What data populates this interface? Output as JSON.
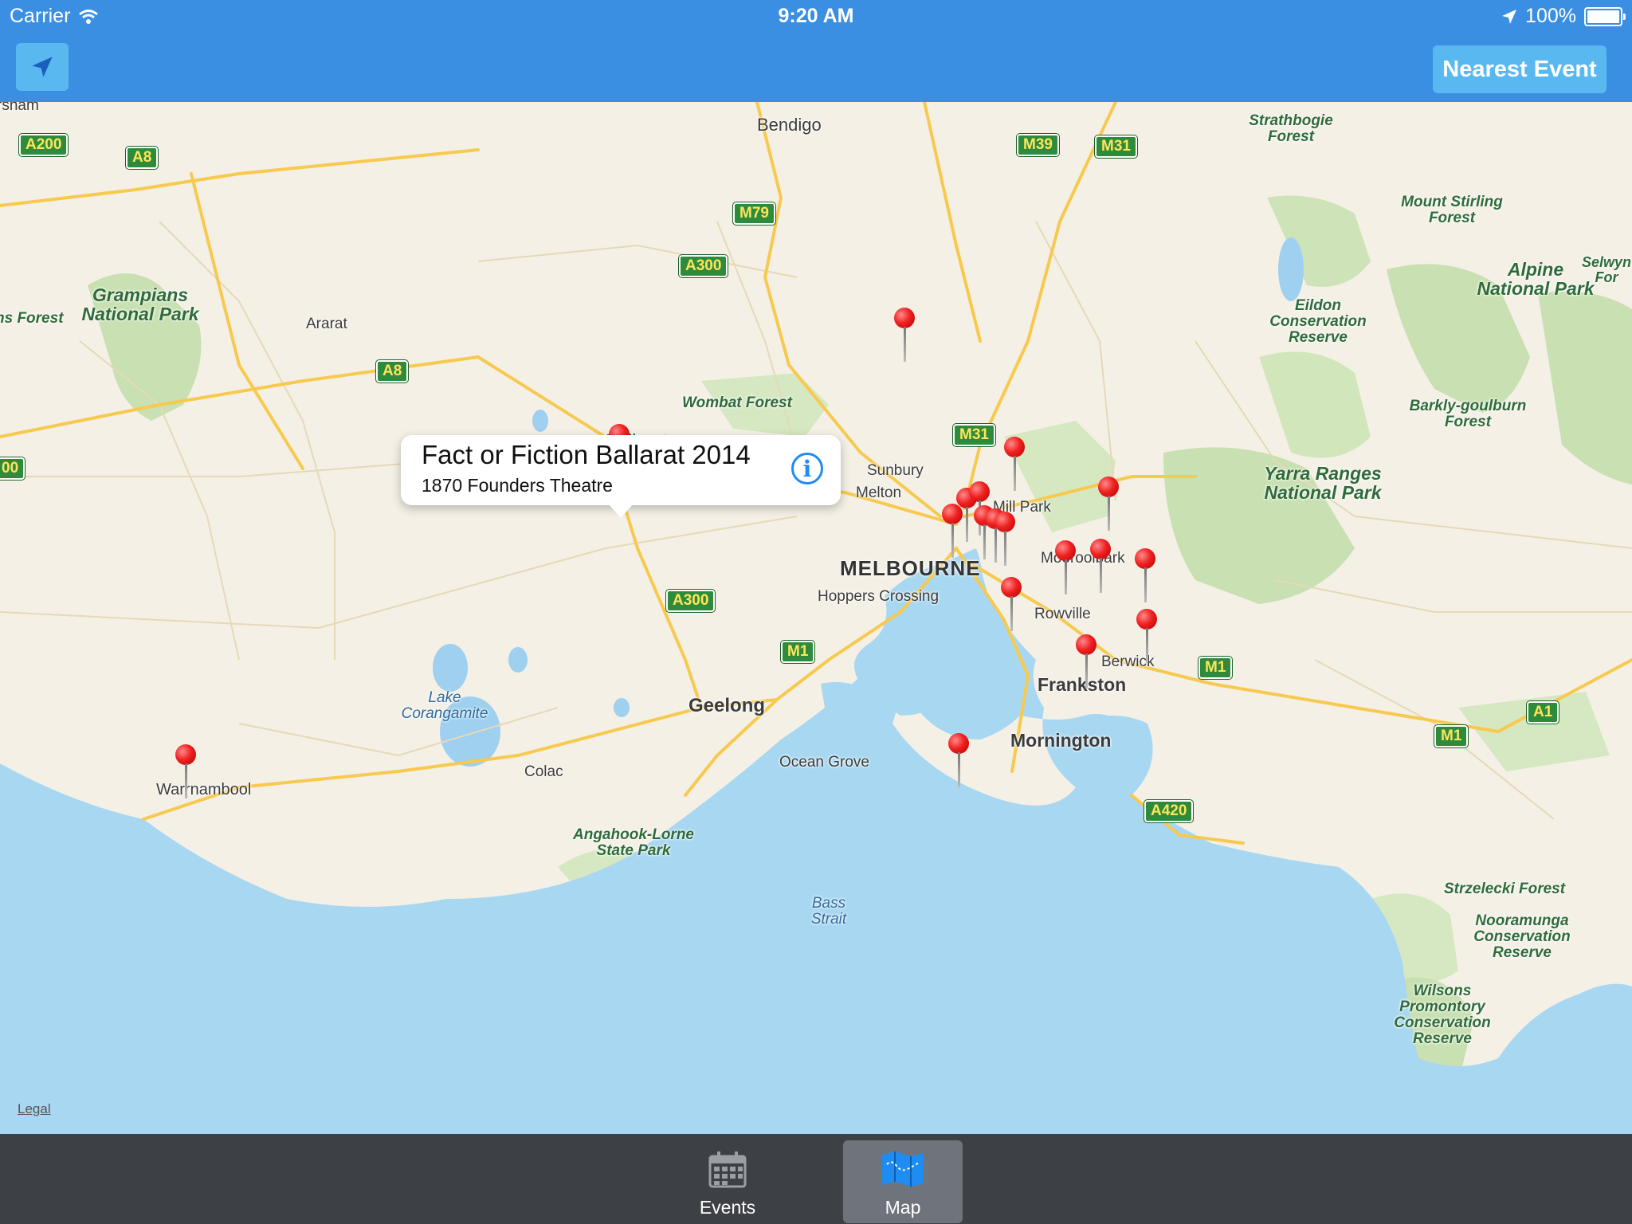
{
  "status_bar": {
    "carrier": "Carrier",
    "time": "9:20 AM",
    "battery": "100%"
  },
  "nav": {
    "nearest_label": "Nearest Event"
  },
  "map": {
    "cities": {
      "bendigo": "Bendigo",
      "ararat": "Ararat",
      "ballarat": "Ballarat",
      "sunbury": "Sunbury",
      "melton": "Melton",
      "melbourne": "MELBOURNE",
      "hoppers": "Hoppers Crossing",
      "rowville": "Rowville",
      "berwick": "Berwick",
      "frankston": "Frankston",
      "geelong": "Geelong",
      "ocean_grove": "Ocean Grove",
      "mornington": "Mornington",
      "colac": "Colac",
      "warrnambool": "Warrnambool",
      "mill_park": "Mill Park",
      "mooroolbark": "Mooroolbark"
    },
    "parks": {
      "grampians": "Grampians National Park",
      "strathbogie": "Strathbogie Forest",
      "mount_stirling": "Mount Stirling Forest",
      "alpine": "Alpine National Park",
      "selwyn": "Selwyn For",
      "eildon": "Eildon Conservation Reserve",
      "barkly": "Barkly-goulburn Forest",
      "yarra": "Yarra Ranges National Park",
      "wombat": "Wombat Forest",
      "angahook": "Angahook-Lorne State Park",
      "strzelecki": "Strzelecki Forest",
      "nooramunga": "Nooramunga Conservation Reserve",
      "wilsons": "Wilsons Promontory Conservation Reserve",
      "ns_forest": "ns Forest",
      "rsham": "rsham"
    },
    "water": {
      "corangamite": "Lake Corangamite",
      "bass": "Bass Strait"
    },
    "roads": {
      "a200": "A200",
      "a8": "A8",
      "m79": "M79",
      "a300": "A300",
      "m39": "M39",
      "m31": "M31",
      "a8b": "A8",
      "a300b": "A300",
      "m1": "M1",
      "m1b": "M1",
      "a1": "A1",
      "m1c": "M1",
      "a420": "A420",
      "m31b": "M31",
      "edge": "00"
    },
    "callout": {
      "title": "Fact or Fiction Ballarat 2014",
      "subtitle": "1870 Founders Theatre",
      "info_icon": "info-icon"
    },
    "legal": "Legal"
  },
  "tabs": [
    {
      "label": "Events",
      "icon": "calendar-icon",
      "selected": false
    },
    {
      "label": "Map",
      "icon": "map-icon",
      "selected": true
    }
  ]
}
